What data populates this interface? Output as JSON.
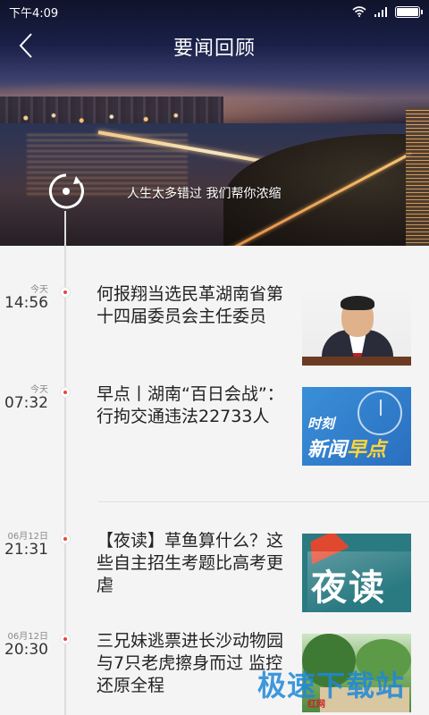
{
  "status_bar": {
    "time": "下午4:09"
  },
  "header": {
    "title": "要闻回顾",
    "tagline": "人生太多错过  我们帮你浓缩"
  },
  "news": [
    {
      "day": "今天",
      "time": "14:56",
      "title": "何报翔当选民革湖南省第十四届委员会主任委员",
      "thumb": "portrait"
    },
    {
      "day": "今天",
      "time": "07:32",
      "title": "早点丨湖南“百日会战”：行拘交通违法22733人",
      "thumb": "morning-news",
      "thumb_text_1": "时刻",
      "thumb_text_2": "新闻",
      "thumb_text_3": "早点"
    },
    {
      "day": "06月12日",
      "time": "21:31",
      "title": "【夜读】草鱼算什么？这些自主招生考题比高考更虐",
      "thumb": "night-read",
      "thumb_text": "夜读"
    },
    {
      "day": "06月12日",
      "time": "20:30",
      "title": "三兄妹逃票进长沙动物园与7只老虎擦身而过 监控还原全程",
      "thumb": "zoo-park",
      "thumb_text": "红网"
    }
  ],
  "watermark": "极速下载站",
  "colors": {
    "accent_dot": "#e8443a",
    "timeline": "#dcdcdc",
    "background": "#f4f4f4"
  }
}
